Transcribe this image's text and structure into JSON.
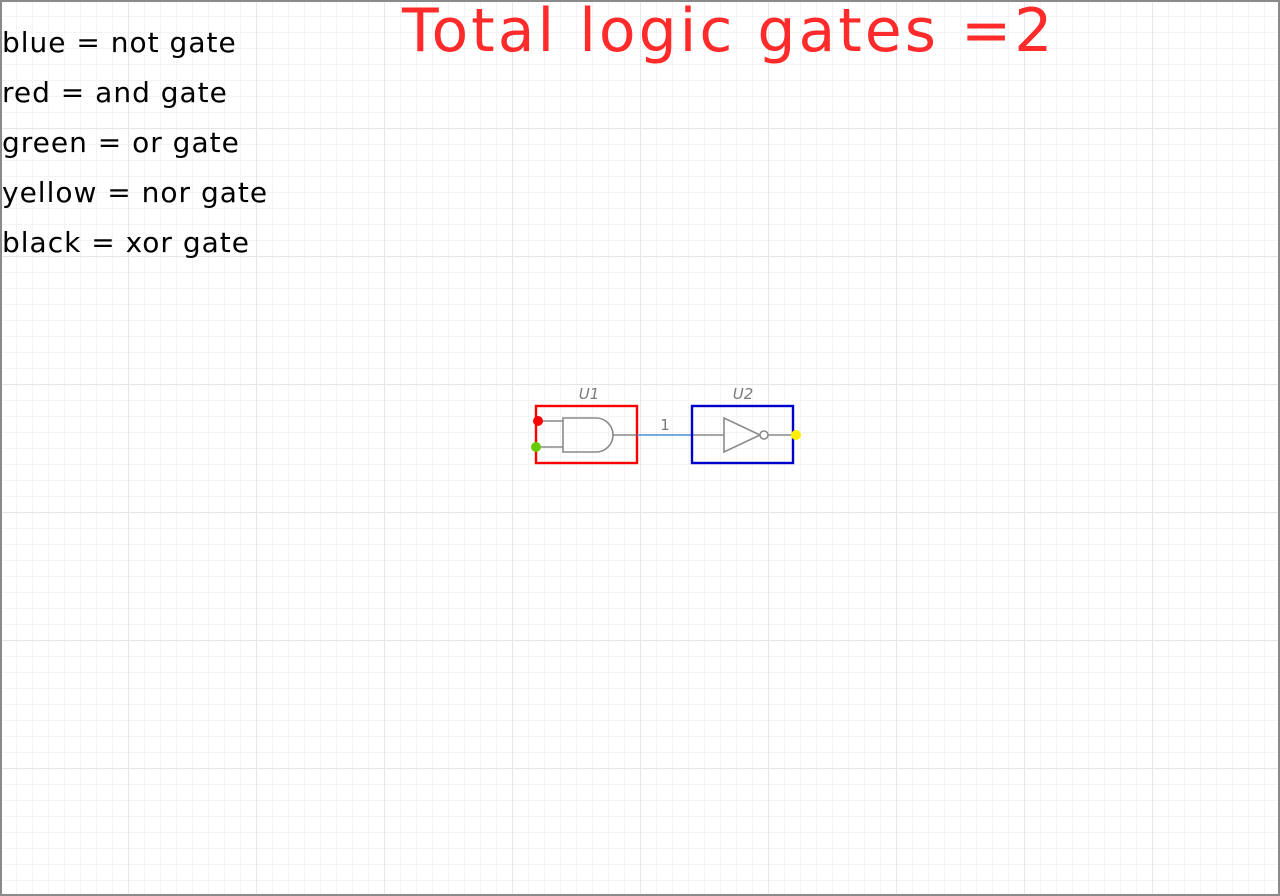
{
  "title": "Total logic gates =2",
  "legend": [
    {
      "text": "blue = not gate",
      "color": "#0000cc"
    },
    {
      "text": "red = and gate",
      "color": "#ff0000"
    },
    {
      "text": "green = or gate",
      "color": "#00cc00"
    },
    {
      "text": "yellow = nor gate",
      "color": "#ffee00"
    },
    {
      "text": "black = xor gate",
      "color": "#000000"
    }
  ],
  "components": [
    {
      "ref": "U1",
      "type": "and gate",
      "highlight_color": "#ff0000"
    },
    {
      "ref": "U2",
      "type": "not gate",
      "highlight_color": "#0000cc"
    }
  ],
  "net": {
    "label": "1",
    "color": "#4a90d9"
  },
  "pin_markers": [
    {
      "pin": "U1 input A",
      "color": "#ff0000"
    },
    {
      "pin": "U1 input B",
      "color": "#66cc00"
    },
    {
      "pin": "U2 output",
      "color": "#ffee00"
    }
  ]
}
